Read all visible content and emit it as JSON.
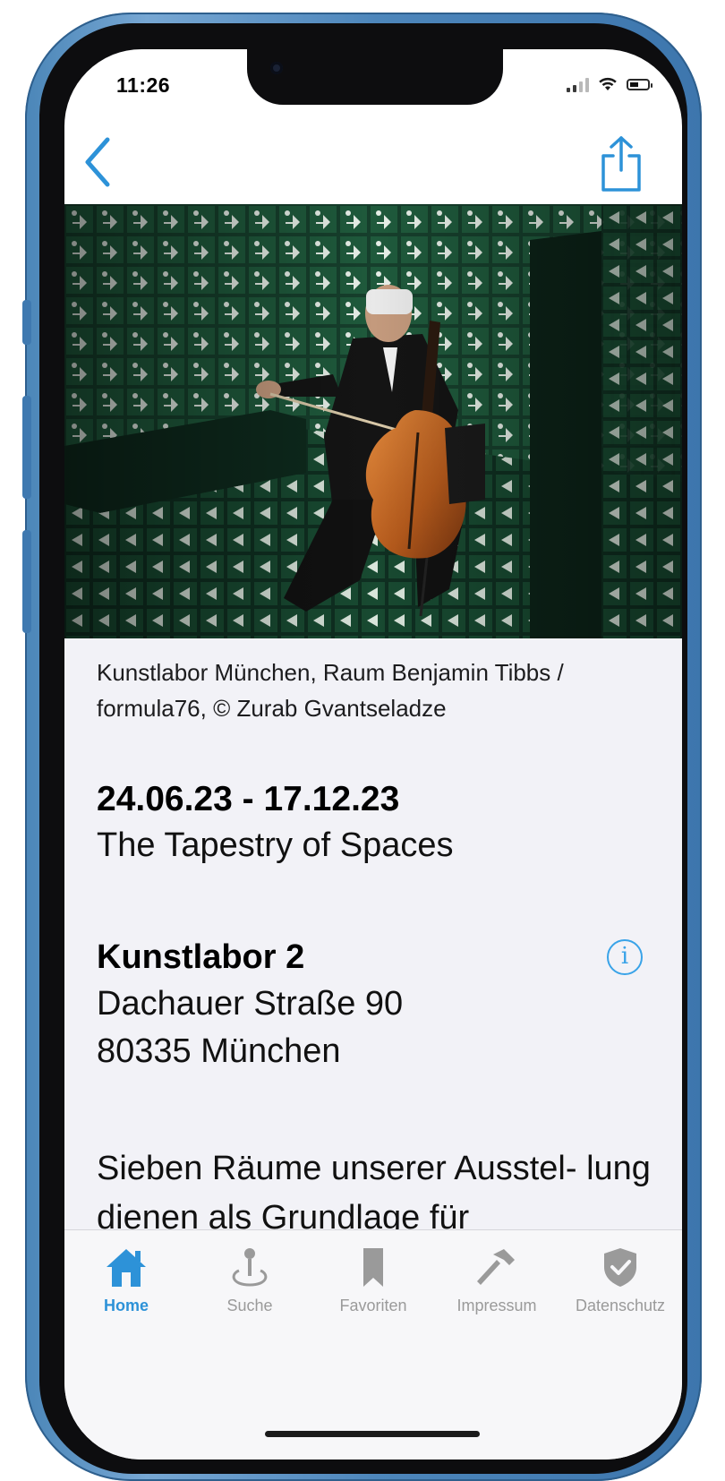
{
  "status_bar": {
    "time": "11:26"
  },
  "nav": {
    "back_icon": "chevron-left-icon",
    "share_icon": "share-icon",
    "accent_color": "#2d92d8"
  },
  "hero": {
    "image": "photo of cellist wearing VR headset in a room covered with green emergency-exit signs"
  },
  "caption": "Kunstlabor München, Raum Benjamin Tibbs / formula76, © Zurab Gvantseladze",
  "event": {
    "date_range": "24.06.23 - 17.12.23",
    "title": "The Tapestry of Spaces"
  },
  "venue": {
    "name": "Kunstlabor 2",
    "street": "Dachauer Straße 90",
    "city": "80335 München",
    "info_icon": "info-icon"
  },
  "description": "Sieben Räume unserer Ausstel- lung dienen als Grundlage für",
  "tabbar": {
    "items": [
      {
        "label": "Home",
        "icon": "house-icon",
        "active": true
      },
      {
        "label": "Suche",
        "icon": "map-pin-icon",
        "active": false
      },
      {
        "label": "Favoriten",
        "icon": "bookmark-icon",
        "active": false
      },
      {
        "label": "Impressum",
        "icon": "hammer-icon",
        "active": false
      },
      {
        "label": "Datenschutz",
        "icon": "shield-icon",
        "active": false
      }
    ],
    "active_color": "#2d92d8",
    "inactive_color": "#9a9a9a"
  }
}
